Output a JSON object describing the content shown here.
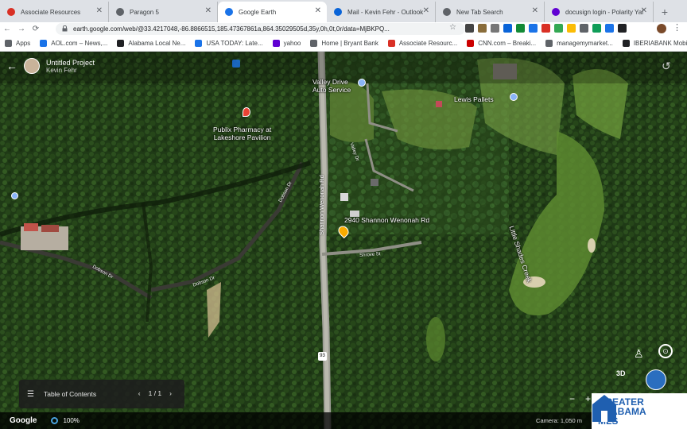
{
  "tabs": [
    {
      "label": "Associate Resources",
      "color": "#d93025"
    },
    {
      "label": "Paragon 5",
      "color": "#5f6368"
    },
    {
      "label": "Google Earth",
      "color": "#1a73e8",
      "active": true
    },
    {
      "label": "Mail - Kevin Fehr - Outlook",
      "color": "#0a64d8"
    },
    {
      "label": "New Tab Search",
      "color": "#5f6368"
    },
    {
      "label": "docusign login - Polarity Yal",
      "color": "#6001d2"
    }
  ],
  "new_tab_label": "+",
  "url": "earth.google.com/web/@33.4217048,-86.8866515,185.47367861a,864.35029505d,35y,0h,0t,0r/data=MjBKPQ...",
  "bookmarks": [
    {
      "label": "Apps",
      "color": "#5f6368"
    },
    {
      "label": "AOL.com – News,...",
      "color": "#1a73e8"
    },
    {
      "label": "Alabama Local Ne...",
      "color": "#202124"
    },
    {
      "label": "USA TODAY: Late...",
      "color": "#1a73e8"
    },
    {
      "label": "yahoo",
      "color": "#6001d2"
    },
    {
      "label": "Home | Bryant Bank",
      "color": "#5f6368"
    },
    {
      "label": "Associate Resourc...",
      "color": "#d93025"
    },
    {
      "label": "CNN.com – Breaki...",
      "color": "#cc0000"
    },
    {
      "label": "managemymarket...",
      "color": "#5f6368"
    },
    {
      "label": "IBERIABANK Mobi...",
      "color": "#202124"
    }
  ],
  "project": {
    "title": "Untitled Project",
    "owner": "Kevin Fehr"
  },
  "places": {
    "valley_drive": "Valley Drive\nAuto Service",
    "lewis_pallets": "Lewis Pallets",
    "publix": "Publix Pharmacy at\nLakeshore Pavilion",
    "address": "2940 Shannon Wenonah Rd",
    "creek": "Little Shades Creek"
  },
  "roads": {
    "shannon": "Shannon Wenonah Rd",
    "dobson_1": "Dobson Dr",
    "dobson_2": "Dobson Dr",
    "dobson_3": "Dobson Dr",
    "shrove": "Shrove St",
    "valley_dr": "Valley Dr",
    "route": "93"
  },
  "toc": {
    "label": "Table of Contents",
    "page": "1 / 1"
  },
  "status": {
    "logo": "Google",
    "zoom": "100%",
    "camera": "Camera: 1,050 m"
  },
  "controls": {
    "three_d": "3D",
    "minus": "−",
    "plus": "+"
  },
  "badge": {
    "line1": "GREATER",
    "line2": "ALABAMA",
    "line3": "MLS"
  }
}
